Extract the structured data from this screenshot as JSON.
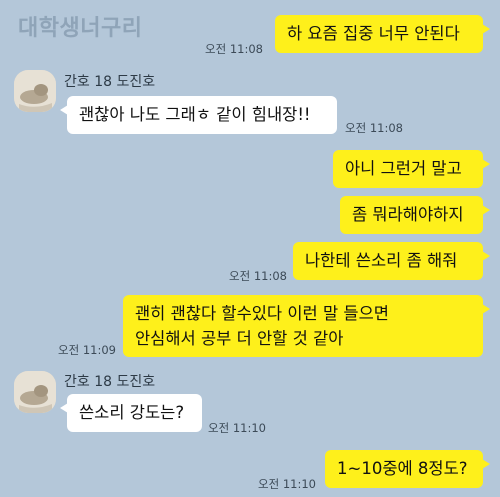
{
  "chat": {
    "watermark": "대학생너구리",
    "sender_name": "간호 18 도진호",
    "messages": [
      {
        "text": "하 요즘 집중 너무 안된다",
        "time": "오전 11:08"
      },
      {
        "text": "괜찮아 나도 그래ㅎ 같이 힘내장!!",
        "time": "오전 11:08"
      },
      {
        "text": "아니 그런거 말고"
      },
      {
        "text": "좀 뭐라해야하지"
      },
      {
        "text": "나한테 쓴소리 좀 해줘",
        "time": "오전 11:08"
      },
      {
        "text_line1": "괜히 괜찮다 할수있다 이런 말 들으면",
        "text_line2": "안심해서 공부 더 안할 것 같아",
        "time": "오전 11:09"
      },
      {
        "text": "쓴소리 강도는?",
        "time": "오전 11:10"
      },
      {
        "text": "1~10중에 8정도?",
        "time": "오전 11:10"
      }
    ]
  }
}
